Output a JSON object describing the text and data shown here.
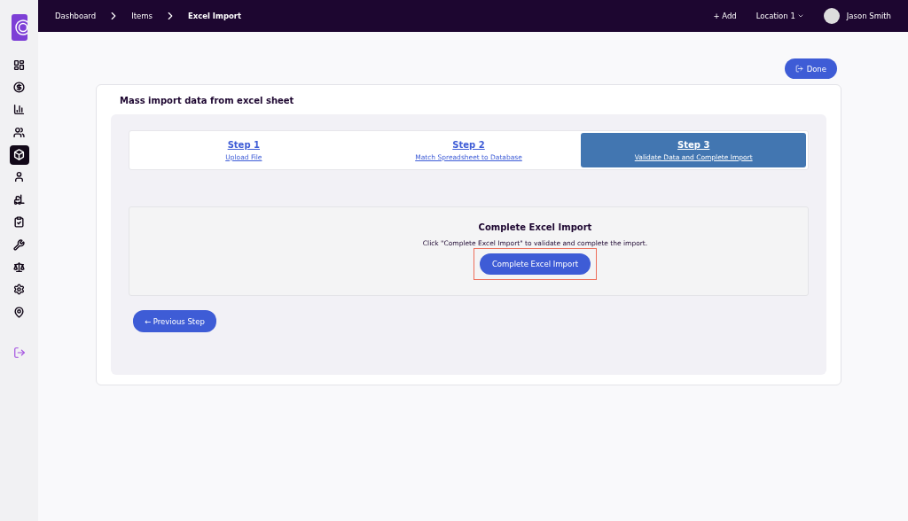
{
  "sidebar": {
    "items": [
      {
        "selected": false
      },
      {
        "selected": false
      },
      {
        "selected": false
      },
      {
        "selected": false
      },
      {
        "selected": true
      },
      {
        "selected": false
      },
      {
        "selected": false
      },
      {
        "selected": false
      },
      {
        "selected": false
      },
      {
        "selected": false
      },
      {
        "selected": false
      },
      {
        "selected": false
      }
    ]
  },
  "breadcrumbs": [
    "Dashboard",
    "Items",
    "Excel Import"
  ],
  "topbar": {
    "add": "+ Add",
    "location": "Location 1",
    "user": "Jason Smith"
  },
  "done_button": "Done",
  "card": {
    "title": "Mass import data from excel sheet"
  },
  "steps": [
    {
      "title": "Step 1",
      "subtitle": "Upload File",
      "selected": false
    },
    {
      "title": "Step 2",
      "subtitle": "Match Spreadsheet to Database",
      "selected": false
    },
    {
      "title": "Step 3",
      "subtitle": "Validate Data and Complete Import",
      "selected": true
    }
  ],
  "complete": {
    "heading": "Complete Excel Import",
    "text": "Click \"Complete Excel Import\" to validate and complete the import.",
    "button": "Complete Excel Import",
    "highlighted": true
  },
  "previous_button": "← Previous Step"
}
